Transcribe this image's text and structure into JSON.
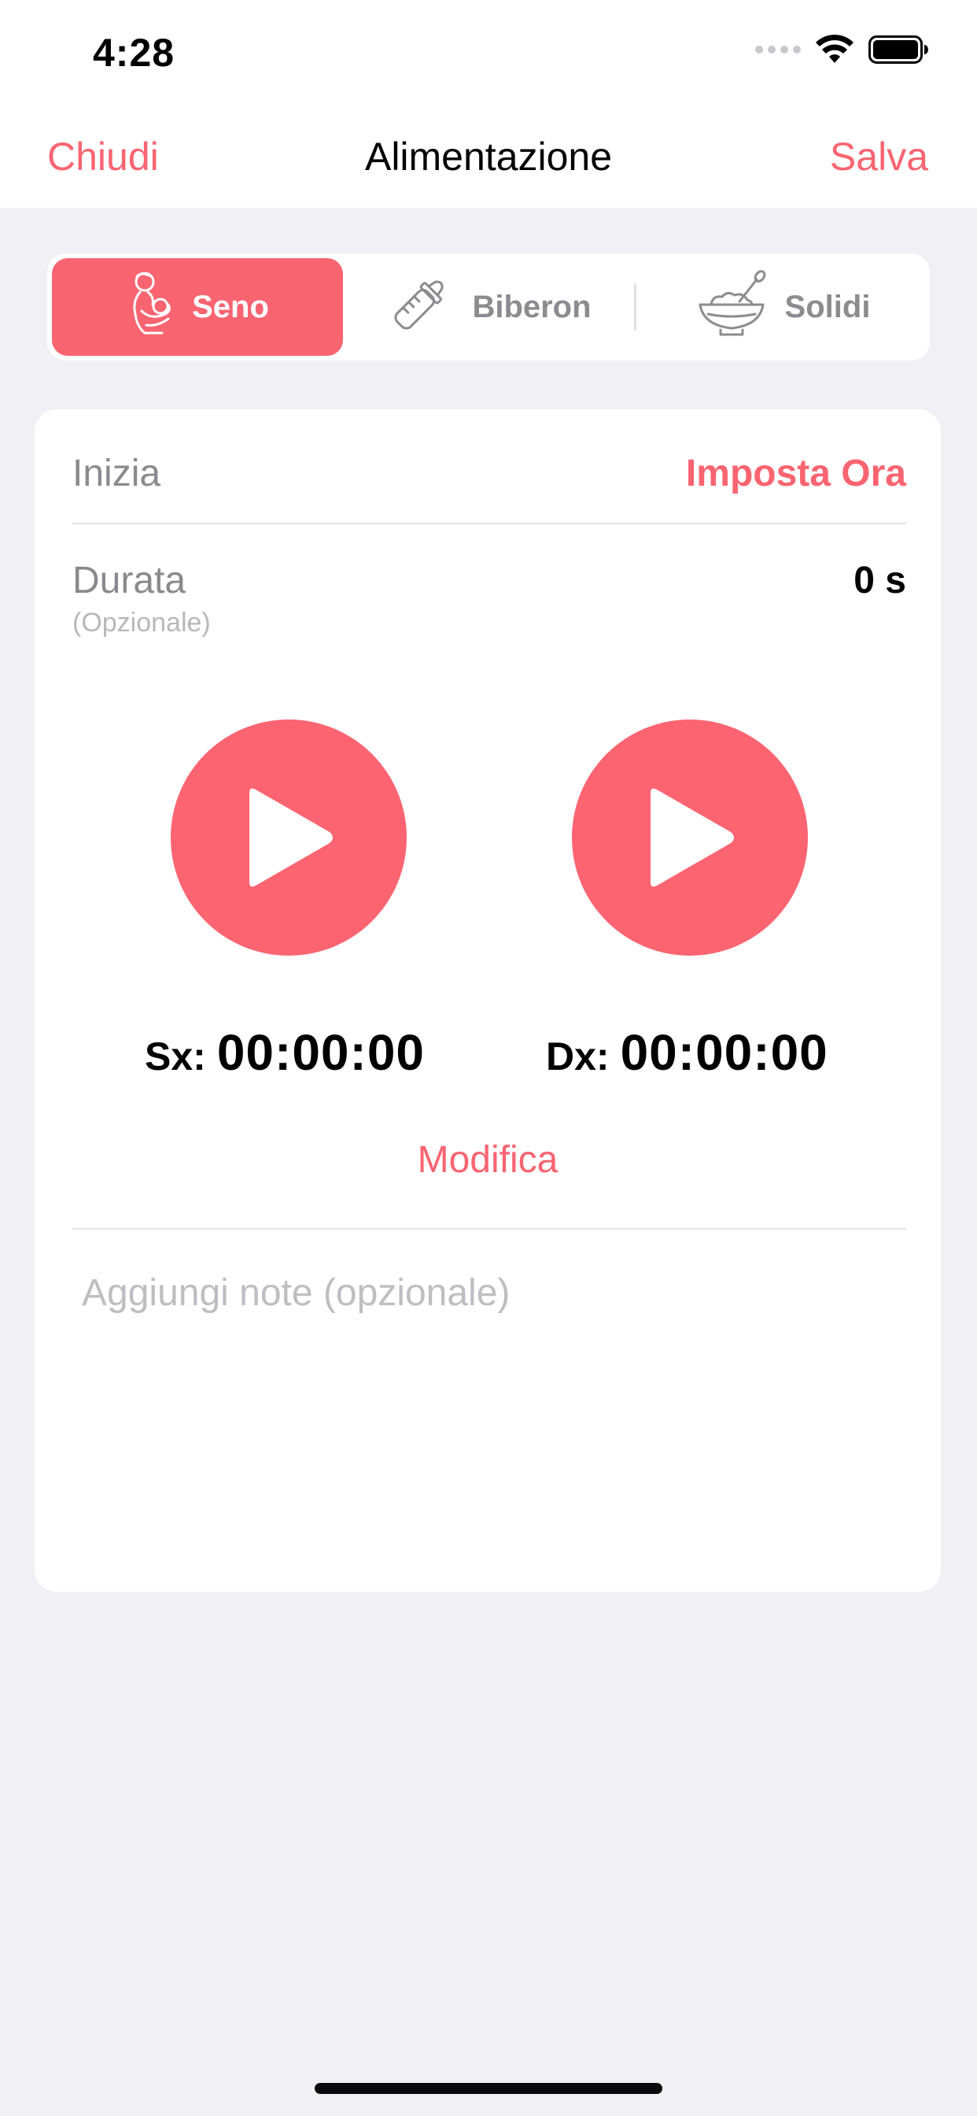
{
  "status": {
    "time": "4:28"
  },
  "nav": {
    "close_label": "Chiudi",
    "title": "Alimentazione",
    "save_label": "Salva"
  },
  "tabs": [
    {
      "label": "Seno",
      "icon": "breastfeeding-icon",
      "selected": true
    },
    {
      "label": "Biberon",
      "icon": "bottle-icon",
      "selected": false
    },
    {
      "label": "Solidi",
      "icon": "bowl-icon",
      "selected": false
    }
  ],
  "form": {
    "start_label": "Inizia",
    "set_time_label": "Imposta Ora",
    "duration_label": "Durata",
    "duration_optional": "(Opzionale)",
    "duration_value": "0 s",
    "left_label": "Sx:",
    "left_time": "00:00:00",
    "right_label": "Dx:",
    "right_time": "00:00:00",
    "edit_label": "Modifica",
    "notes_placeholder": "Aggiungi note (opzionale)"
  },
  "colors": {
    "accent": "#F96471",
    "background": "#F0F0F5"
  }
}
